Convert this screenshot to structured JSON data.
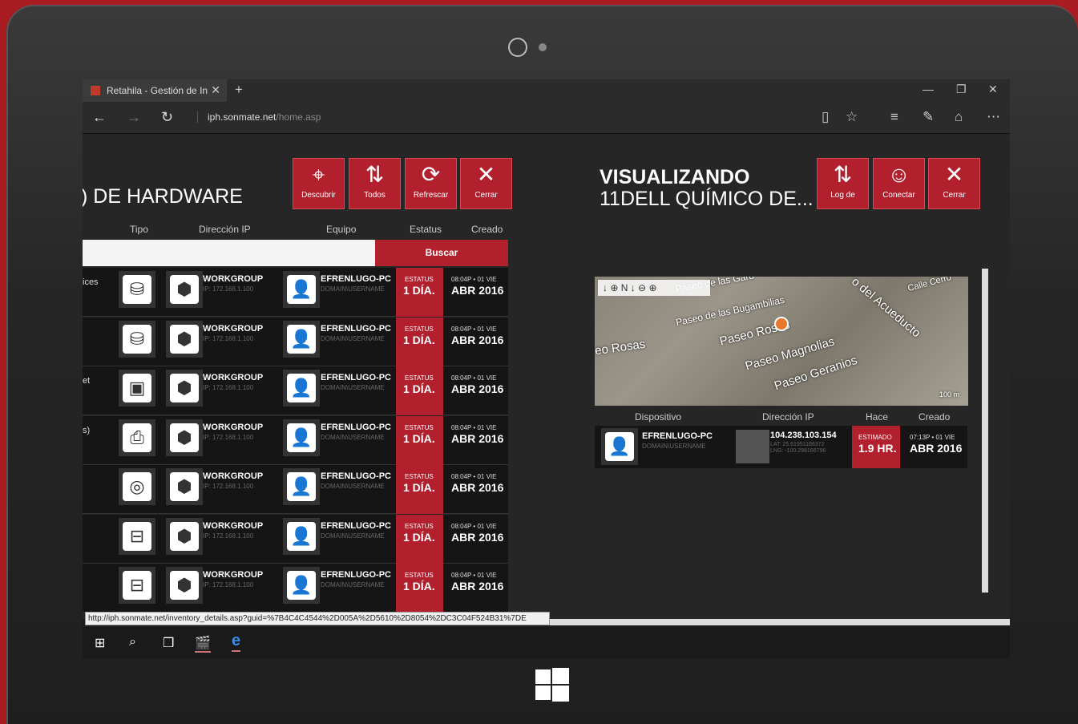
{
  "browser": {
    "tab_title": "Retahila - Gestión de In",
    "url_host": "iph.sonmate.net",
    "url_path": "/home.asp",
    "status_url": "http://iph.sonmate.net/inventory_details.asp?guid=%7B4C4C4544%2D005A%2D5610%2D8054%2DC3C04F524B31%7DE"
  },
  "left_panel": {
    "title": ") DE HARDWARE",
    "buttons": [
      {
        "label": "Descubrir",
        "icon": "crosshair-icon",
        "glyph": "⌖"
      },
      {
        "label": "Todos",
        "icon": "sort-icon",
        "glyph": "⇅"
      },
      {
        "label": "Refrescar",
        "icon": "refresh-icon",
        "glyph": "⟳"
      },
      {
        "label": "Cerrar",
        "icon": "close-icon",
        "glyph": "✕"
      }
    ],
    "columns": [
      "Tipo",
      "Dirección IP",
      "Equipo",
      "Estatus",
      "Creado"
    ],
    "search_label": "Buscar",
    "rows": [
      {
        "side": "ices",
        "type_icon": "hard-drive-icon",
        "glyph": "⛁",
        "workgroup": "WORKGROUP",
        "ip": "IP: 172.168.1.100",
        "equipo": "EFRENLUGO-PC",
        "domain": "DOMAIN\\USERNAME",
        "estatus_label": "ESTATUS",
        "estatus": "1 DÍA.",
        "created_time": "08:04P • 01 VIE",
        "created_date": "ABR 2016"
      },
      {
        "side": "",
        "type_icon": "hard-drive-icon",
        "glyph": "⛁",
        "workgroup": "WORKGROUP",
        "ip": "IP: 172.168.1.100",
        "equipo": "EFRENLUGO-PC",
        "domain": "DOMAIN\\USERNAME",
        "estatus_label": "ESTATUS",
        "estatus": "1 DÍA.",
        "created_time": "08:04P • 01 VIE",
        "created_date": "ABR 2016"
      },
      {
        "side": "et",
        "type_icon": "cpu-icon",
        "glyph": "▣",
        "workgroup": "WORKGROUP",
        "ip": "IP: 172.168.1.100",
        "equipo": "EFRENLUGO-PC",
        "domain": "DOMAIN\\USERNAME",
        "estatus_label": "ESTATUS",
        "estatus": "1 DÍA.",
        "created_time": "08:04P • 01 VIE",
        "created_date": "ABR 2016"
      },
      {
        "side": "s)",
        "type_icon": "printer-icon",
        "glyph": "⎙",
        "workgroup": "WORKGROUP",
        "ip": "IP: 172.168.1.100",
        "equipo": "EFRENLUGO-PC",
        "domain": "DOMAIN\\USERNAME",
        "estatus_label": "ESTATUS",
        "estatus": "1 DÍA.",
        "created_time": "08:04P • 01 VIE",
        "created_date": "ABR 2016"
      },
      {
        "side": "",
        "type_icon": "disc-icon",
        "glyph": "◎",
        "workgroup": "WORKGROUP",
        "ip": "IP: 172.168.1.100",
        "equipo": "EFRENLUGO-PC",
        "domain": "DOMAIN\\USERNAME",
        "estatus_label": "ESTATUS",
        "estatus": "1 DÍA.",
        "created_time": "08:04P • 01 VIE",
        "created_date": "ABR 2016"
      },
      {
        "side": "",
        "type_icon": "network-card-icon",
        "glyph": "⊟",
        "workgroup": "WORKGROUP",
        "ip": "IP: 172.168.1.100",
        "equipo": "EFRENLUGO-PC",
        "domain": "DOMAIN\\USERNAME",
        "estatus_label": "ESTATUS",
        "estatus": "1 DÍA.",
        "created_time": "08:04P • 01 VIE",
        "created_date": "ABR 2016"
      },
      {
        "side": "",
        "type_icon": "network-card-icon",
        "glyph": "⊟",
        "workgroup": "WORKGROUP",
        "ip": "IP: 172.168.1.100",
        "equipo": "EFRENLUGO-PC",
        "domain": "DOMAIN\\USERNAME",
        "estatus_label": "ESTATUS",
        "estatus": "1 DÍA.",
        "created_time": "08:04P • 01 VIE",
        "created_date": "ABR 2016"
      }
    ]
  },
  "right_panel": {
    "title_line1": "VISUALIZANDO",
    "title_line2": "11DELL QUÍMICO DE...",
    "buttons": [
      {
        "label": "Log de",
        "icon": "sort-icon",
        "glyph": "⇅"
      },
      {
        "label": "Conectar",
        "icon": "connect-icon",
        "glyph": "☺"
      },
      {
        "label": "Cerrar",
        "icon": "close-icon",
        "glyph": "✕"
      }
    ],
    "map_labels": [
      "Paseo de las Gard",
      "Paseo de las Bugambilias",
      "Paseo Rosas",
      "Paseo Magnolias",
      "Paseo Geranios",
      "eo Rosas",
      "o del Acueducto",
      "Calle Cerro"
    ],
    "map_scale": "100 m",
    "columns": [
      "Dispositivo",
      "Dirección IP",
      "Hace",
      "Creado"
    ],
    "row": {
      "device": "EFRENLUGO-PC",
      "domain": "DOMAIN\\USERNAME",
      "ip": "104.238.103.154",
      "lat": "LAT: 25.61951166372",
      "lng": "LNG: -100.298166796",
      "est_label": "ESTIMADO",
      "hace": "1.9 HR.",
      "created_time": "07:13P • 01 VIE",
      "created_date": "ABR 2016"
    }
  }
}
